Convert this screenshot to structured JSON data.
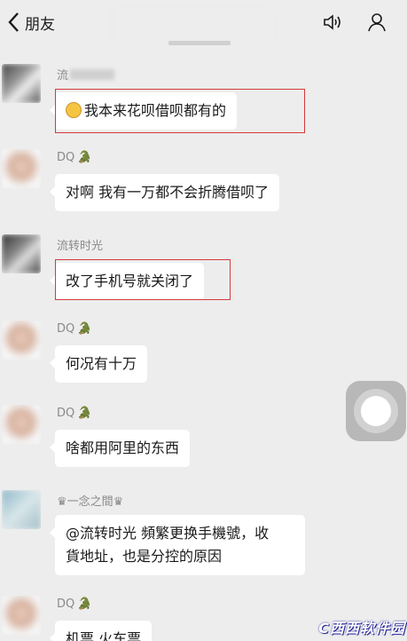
{
  "header": {
    "back_label": "朋友",
    "title": "",
    "speaker_icon": "speaker-icon",
    "profile_icon": "profile-icon"
  },
  "messages": [
    {
      "sender": "流",
      "text": "我本来花呗借呗都有的",
      "emoji": "smile-emoji",
      "highlighted": true
    },
    {
      "sender": "DQ",
      "badge": "🐊",
      "text": "对啊  我有一万都不会折腾借呗了",
      "highlighted": false
    },
    {
      "sender": "流转时光",
      "text": "改了手机号就关闭了",
      "highlighted": true
    },
    {
      "sender": "DQ",
      "badge": "🐊",
      "text": "何况有十万",
      "highlighted": false
    },
    {
      "sender": "DQ",
      "badge": "🐊",
      "text": "啥都用阿里的东西",
      "highlighted": false
    },
    {
      "sender": "♛一念之間♛",
      "text_line1": "@流转时光 頻繁更换手機號，收",
      "text_line2": "貨地址，也是分控的原因",
      "highlighted": false
    },
    {
      "sender": "DQ",
      "badge": "🐊",
      "text": "机票  火车票",
      "highlighted": false
    }
  ],
  "watermark": "C西西软件园",
  "colors": {
    "background": "#ededed",
    "bubble": "#ffffff",
    "highlight": "#d43a3a",
    "name": "#8a8a8a"
  }
}
